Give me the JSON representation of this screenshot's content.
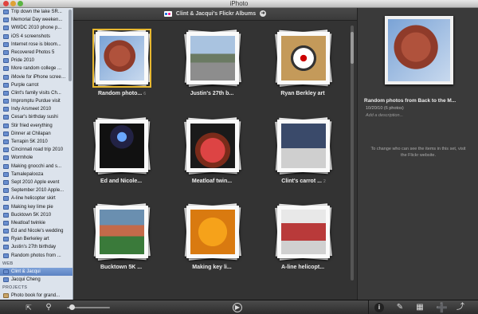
{
  "window": {
    "title": "iPhoto"
  },
  "sidebar": {
    "events": [
      "Trip down the lake SR...",
      "Memorial Day weeken...",
      "WWDC 2010 phone p...",
      "iOS 4 screenshots",
      "Internet rose is bloom...",
      "Recovered Photos 5",
      "Pride 2010",
      "More random college ...",
      "iMovie for iPhone screens",
      "Purple carrot",
      "Clint's family visits Ch...",
      "Impromptu Purdue visit",
      "Indy Arsmeet 2010",
      "Cesar's birthday sushi",
      "Stir fried everything",
      "Dinner at Chilapan",
      "Terrapin 5K 2010",
      "Cincinnati road trip 2010",
      "Wormhole",
      "Making gnocchi and s...",
      "Tamalepalooza",
      "Sept 2010 Apple event",
      "September 2010 Apple...",
      "A-line helicopter skirt",
      "Making key lime pie",
      "Bucktown 5K 2010",
      "Meatloaf twinkie",
      "Ed and Nicole's wedding",
      "Ryan Berkeley art",
      "Justin's 27th birthday",
      "Random photos from ..."
    ],
    "web_header": "WEB",
    "web_items": [
      "Clint & Jacqui",
      "Jacqui Cheng"
    ],
    "projects_header": "PROJECTS",
    "project_items": [
      "Photo book for grand..."
    ]
  },
  "main": {
    "header_title": "Clint & Jacqui's Flickr Albums",
    "albums": [
      {
        "label": "Random photo...",
        "count": "6",
        "image": "apple-mac-photo",
        "selected": true
      },
      {
        "label": "Justin's 27th b...",
        "count": "",
        "image": "street-photo",
        "selected": false
      },
      {
        "label": "Ryan Berkley art",
        "count": "",
        "image": "framed-art-photo",
        "selected": false
      },
      {
        "label": "Ed and Nicole...",
        "count": "",
        "image": "wedding-party-photo",
        "selected": false
      },
      {
        "label": "Meatloaf twin...",
        "count": "",
        "image": "meatloaf-photo",
        "selected": false
      },
      {
        "label": "Clint's carrot ...",
        "count": "2",
        "image": "laptop-photo",
        "selected": false
      },
      {
        "label": "Bucktown 5K ...",
        "count": "",
        "image": "group-runners-photo",
        "selected": false
      },
      {
        "label": "Making key li...",
        "count": "",
        "image": "pie-crust-photo",
        "selected": false
      },
      {
        "label": "A-line helicopt...",
        "count": "",
        "image": "skirt-photo",
        "selected": false
      }
    ]
  },
  "info": {
    "title": "Random photos from Back to the M...",
    "meta": "10/20/10 (6 photos)",
    "description_placeholder": "Add a description...",
    "note": "To change who can see the items in this set, visit the Flickr website."
  },
  "toolbar": {
    "icons": [
      "fullscreen-icon",
      "search-icon",
      "zoom-slider",
      "slideshow-play-icon",
      "info-icon",
      "edit-icon",
      "effects-icon",
      "add-to-icon",
      "share-icon"
    ]
  }
}
